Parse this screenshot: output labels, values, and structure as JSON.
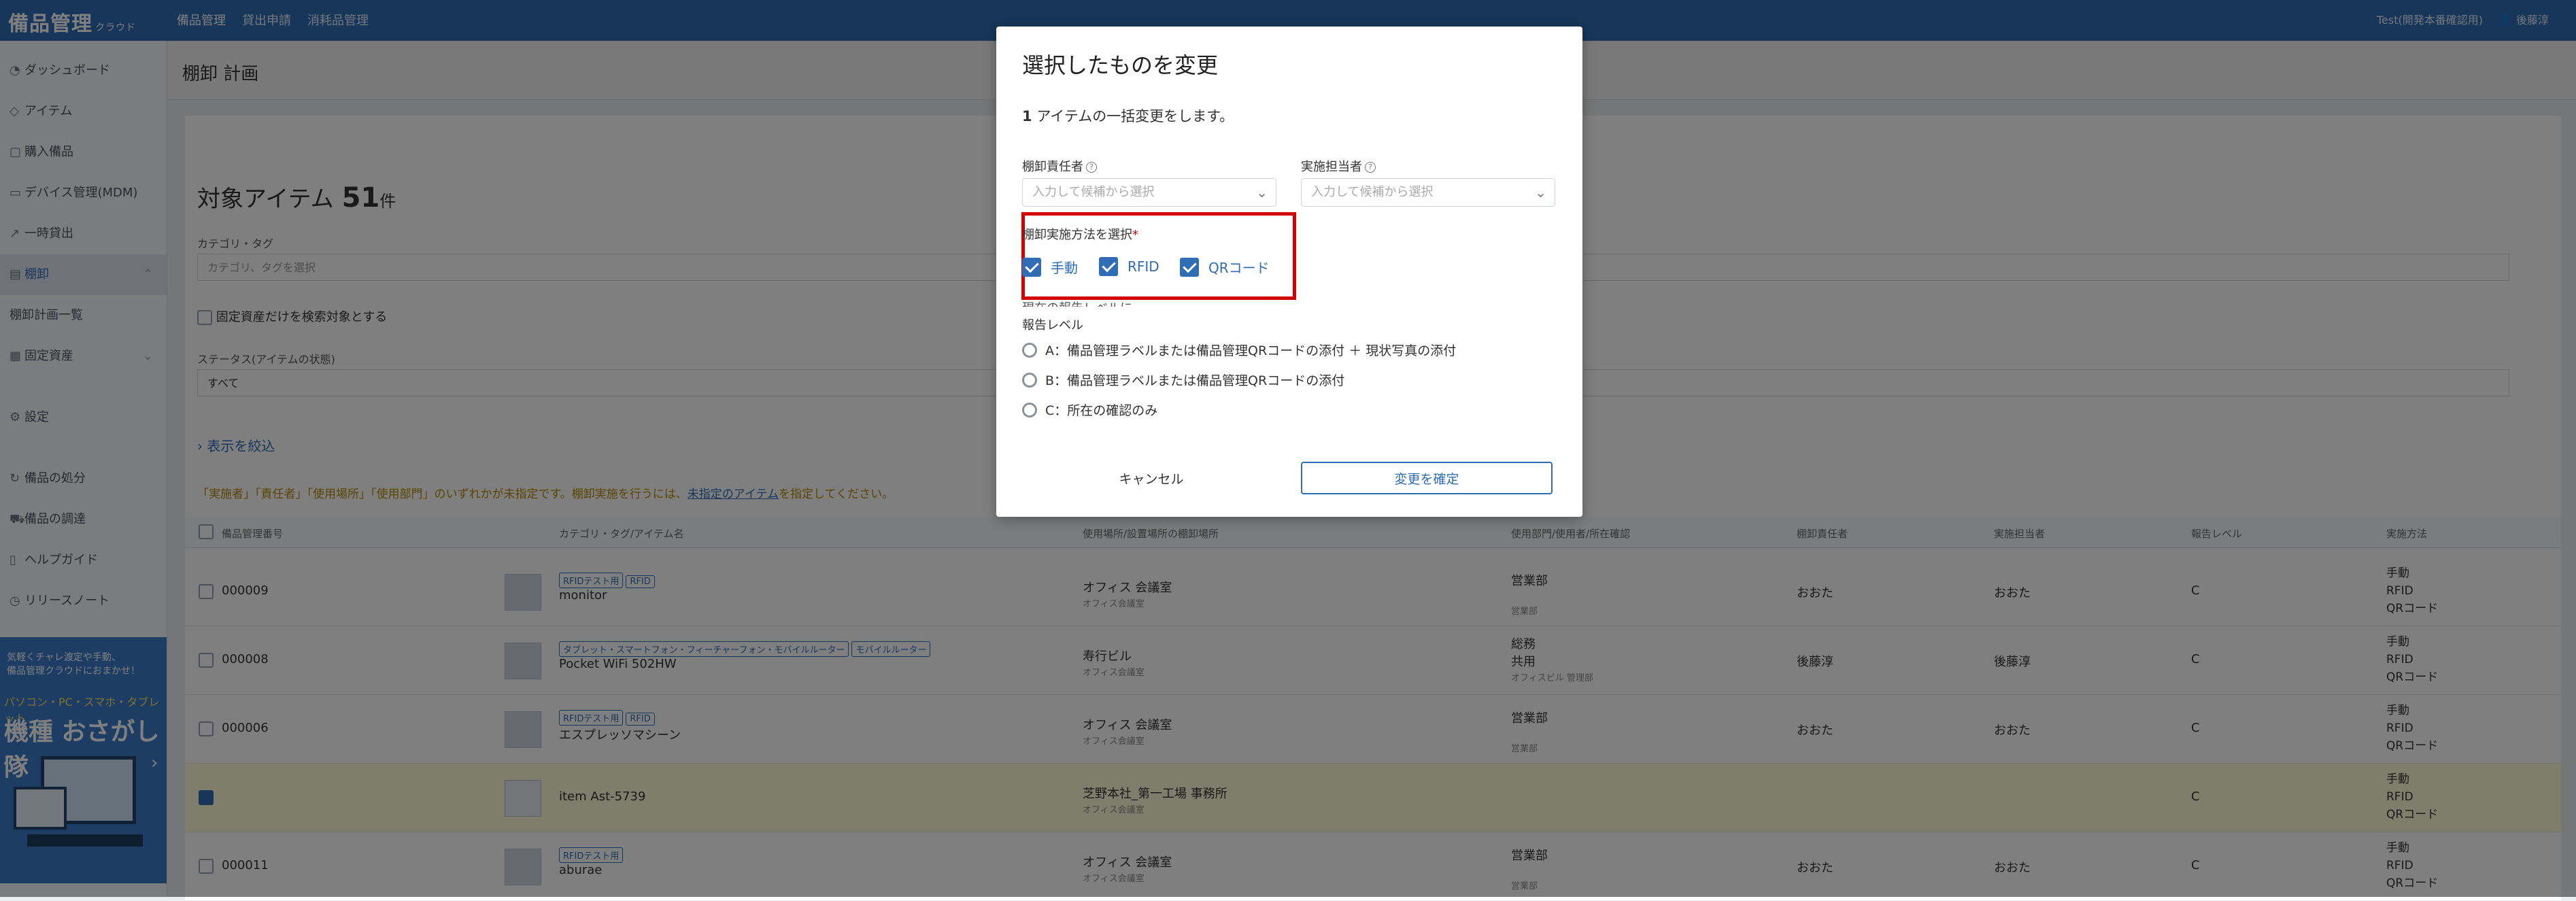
{
  "app": {
    "logo": "備品管理",
    "logo_sub": "クラウド",
    "nav": [
      "備品管理",
      "貸出申請",
      "消耗品管理"
    ],
    "user_org": "Test(開発本番確認用)",
    "user_name": "後藤淳"
  },
  "sidebar": {
    "items": [
      {
        "label": "ダッシュボード"
      },
      {
        "label": "アイテム"
      },
      {
        "label": "購入備品"
      },
      {
        "label": "デバイス管理(MDM)"
      },
      {
        "label": "一時貸出"
      },
      {
        "label": "棚卸"
      },
      {
        "label": "棚卸計画一覧"
      },
      {
        "label": "固定資産"
      },
      {
        "label": "設定"
      },
      {
        "label": "備品の処分"
      },
      {
        "label": "備品の調達"
      },
      {
        "label": "ヘルプガイド"
      },
      {
        "label": "リリースノート"
      }
    ],
    "banner": {
      "line1": "気軽くチャレ渡定や手動、",
      "line2": "備品管理クラウドにおまかせ！",
      "line3": "パソコン・PC・スマホ・タブレット",
      "headline": "機種 おさがし隊"
    }
  },
  "page": {
    "title": "棚卸 計画",
    "target_label": "対象アイテム",
    "target_count": "51",
    "target_unit": "件",
    "category_tag_label": "カテゴリ・タグ",
    "category_tag_placeholder": "カテゴリ、タグを選択",
    "fixed_asset_only": "固定資産だけを検索対象とする",
    "status_label": "ステータス(アイテムの状態)",
    "status_value": "すべて",
    "filter_link": "表示を絞込",
    "warning_pre": "「実施者」「責任者」「使用場所」「使用部門」のいずれかが未指定です。棚卸実施を行うには、",
    "warning_link": "未指定のアイテム",
    "warning_post": "を指定してください。"
  },
  "table": {
    "headers": [
      "備品管理番号",
      "カテゴリ・タグ/アイテム名",
      "使用場所/設置場所の棚卸場所",
      "使用部門/使用者/所在確認",
      "棚卸責任者",
      "実施担当者",
      "報告レベル",
      "実施方法"
    ],
    "rows": [
      {
        "id": "000009",
        "tags": [
          "RFIDテスト用",
          "RFID"
        ],
        "name": "monitor",
        "place": "オフィス 会議室",
        "place_sub": "オフィス会議室",
        "dept": "営業部",
        "dept2": "",
        "dept_sub": "営業部",
        "resp": "おおた",
        "exec": "おおた",
        "level": "C",
        "methods": [
          "手動",
          "RFID",
          "QRコード"
        ]
      },
      {
        "id": "000008",
        "tags": [
          "タブレット・スマートフォン・フィーチャーフォン・モバイルルーター",
          "モバイルルーター"
        ],
        "name": "Pocket WiFi 502HW",
        "place": "寿行ビル",
        "place_sub": "オフィス会議室",
        "dept": "総務",
        "dept2": "共用",
        "dept_sub": "オフィスビル 管理部",
        "resp": "後藤淳",
        "exec": "後藤淳",
        "level": "C",
        "methods": [
          "手動",
          "RFID",
          "QRコード"
        ]
      },
      {
        "id": "000006",
        "tags": [
          "RFIDテスト用",
          "RFID"
        ],
        "name": "エスプレッソマシーン",
        "place": "オフィス 会議室",
        "place_sub": "オフィス会議室",
        "dept": "営業部",
        "dept2": "",
        "dept_sub": "営業部",
        "resp": "おおた",
        "exec": "おおた",
        "level": "C",
        "methods": [
          "手動",
          "RFID",
          "QRコード"
        ]
      },
      {
        "id": "",
        "tags": [],
        "name": "item Ast-5739",
        "place": "芝野本社_第一工場 事務所",
        "place_sub": "オフィス会議室",
        "dept": "",
        "dept2": "",
        "dept_sub": "",
        "resp": "",
        "exec": "",
        "level": "C",
        "methods": [
          "手動",
          "RFID",
          "QRコード"
        ]
      },
      {
        "id": "000011",
        "tags": [
          "RFIDテスト用"
        ],
        "name": "aburae",
        "place": "オフィス 会議室",
        "place_sub": "オフィス会議室",
        "dept": "営業部",
        "dept2": "",
        "dept_sub": "営業部",
        "resp": "おおた",
        "exec": "おおた",
        "level": "C",
        "methods": [
          "手動",
          "RFID",
          "QRコード"
        ]
      }
    ]
  },
  "modal": {
    "title": "選択したものを変更",
    "desc_count": "1",
    "desc_text": "アイテムの一括変更をします。",
    "responsible_label": "棚卸責任者",
    "responsible_placeholder": "入力して候補から選択",
    "executor_label": "実施担当者",
    "executor_placeholder": "入力して候補から選択",
    "method_label": "棚卸実施方法を選択",
    "required_mark": "*",
    "methods": [
      {
        "label": "手動",
        "checked": true
      },
      {
        "label": "RFID",
        "checked": true
      },
      {
        "label": "QRコード",
        "checked": true
      }
    ],
    "cut_label": "現在の報告レベルに",
    "report_label": "報告レベル",
    "report_options": [
      {
        "label": "A：備品管理ラベルまたは備品管理QRコードの添付 ＋ 現状写真の添付"
      },
      {
        "label": "B：備品管理ラベルまたは備品管理QRコードの添付"
      },
      {
        "label": "C：所在の確認のみ"
      }
    ],
    "cancel_label": "キャンセル",
    "confirm_label": "変更を確定"
  },
  "colors": {
    "primary": "#2f6db5",
    "highlight": "#d40000",
    "overlay": "rgba(0,0,0,0.5)"
  }
}
